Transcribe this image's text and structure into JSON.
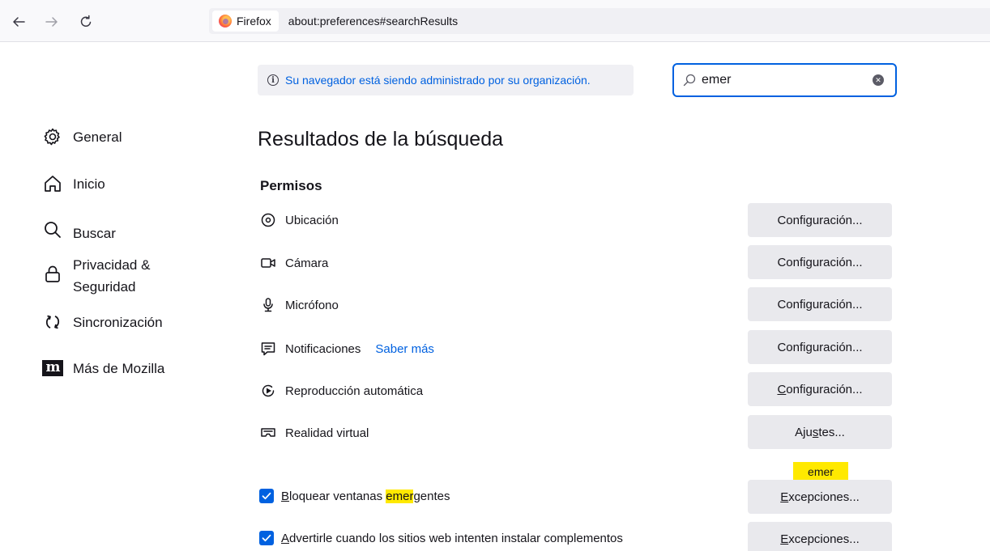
{
  "browser": {
    "identity_label": "Firefox",
    "url": "about:preferences#searchResults"
  },
  "managed_notice": {
    "icon": "info-icon",
    "text": "Su navegador está siendo administrado por su organización."
  },
  "search": {
    "value": "emer",
    "icon": "search-icon"
  },
  "sidebar": {
    "items": [
      {
        "label": "General",
        "icon": "gear-icon"
      },
      {
        "label": "Inicio",
        "icon": "home-icon"
      },
      {
        "label": "Buscar",
        "icon": "search-icon"
      },
      {
        "label": "Privacidad &",
        "label2": "Seguridad",
        "icon": "lock-icon"
      },
      {
        "label": "Sincronización",
        "icon": "sync-icon"
      },
      {
        "label": "Más de Mozilla",
        "icon": "mozilla-icon",
        "badge": "m"
      }
    ]
  },
  "main": {
    "heading": "Resultados de la búsqueda",
    "section": "Permisos",
    "permissions": [
      {
        "label": "Ubicación",
        "icon": "location-icon",
        "button_pre": "Confi",
        "button_key": "g",
        "button_post": "uración..."
      },
      {
        "label": "Cámara",
        "icon": "camera-icon",
        "button_pre": "Confi",
        "button_key": "g",
        "button_post": "uración..."
      },
      {
        "label": "Micrófono",
        "icon": "microphone-icon",
        "button_pre": "Confi",
        "button_key": "g",
        "button_post": "uración..."
      },
      {
        "label": "Notificaciones",
        "link": "Saber más",
        "icon": "notification-icon",
        "button_pre": "Confi",
        "button_key": "g",
        "button_post": "uración..."
      },
      {
        "label": "Reproducción automática",
        "icon": "autoplay-icon",
        "button_pre": "",
        "button_key": "C",
        "button_post": "onfiguración..."
      },
      {
        "label": "Realidad virtual",
        "icon": "vr-icon",
        "button_pre": "Aju",
        "button_key": "s",
        "button_post": "tes..."
      }
    ],
    "popup_block": {
      "checked": true,
      "label_key": "B",
      "label_pre": "loquear ventanas ",
      "label_hl": "emer",
      "label_post": "gentes",
      "tooltip": "emer",
      "button_key": "E",
      "button_post": "xcepciones..."
    },
    "addons_warn": {
      "checked": true,
      "label_key": "A",
      "label_post": "dvertirle cuando los sitios web intenten instalar complementos",
      "button_key": "E",
      "button_post": "xcepciones..."
    }
  },
  "colors": {
    "accent": "#0061e0",
    "highlight": "#ffe900",
    "button_bg": "#e9e9ed"
  }
}
